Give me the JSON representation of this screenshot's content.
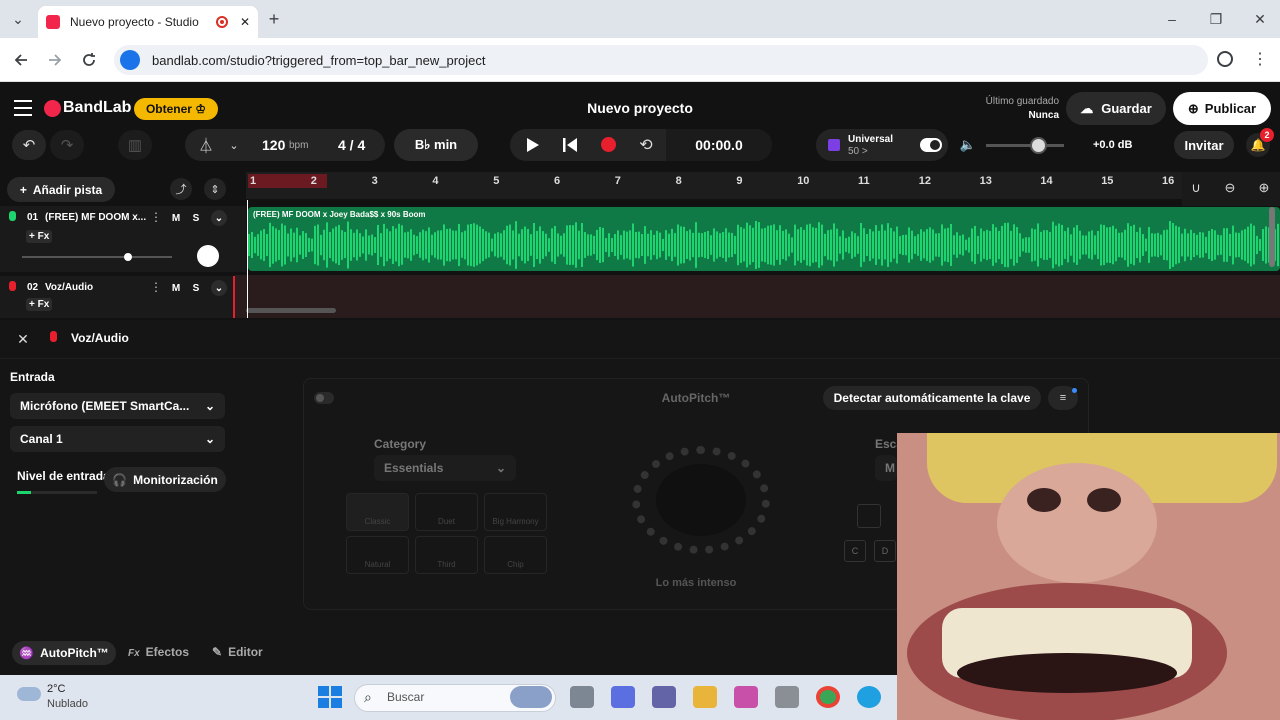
{
  "browser": {
    "tab_title": "Nuevo proyecto - Studio",
    "url": "bandlab.com/studio?triggered_from=top_bar_new_project",
    "new_tab": "+",
    "menu_glyph": "⌄",
    "min": "–",
    "max": "❐",
    "close": "✕"
  },
  "header": {
    "logo": "BandLab",
    "get_label": "Obtener",
    "project_title": "Nuevo proyecto",
    "last_saved_label": "Último guardado",
    "last_saved_value": "Nunca",
    "save_label": "Guardar",
    "publish_label": "Publicar"
  },
  "transport": {
    "tempo": "120",
    "tempo_unit": "bpm",
    "time_sig": "4 / 4",
    "key": "B♭ min",
    "time": "00:00.0",
    "instrument_name": "Universal",
    "instrument_sub": "50 >",
    "volume": "+0.0 dB",
    "invite": "Invitar",
    "notifications": "2"
  },
  "tracks": {
    "add_label": "Añadir pista",
    "items": [
      {
        "num": "01",
        "name": "(FREE) MF DOOM x...",
        "fx": "+ Fx",
        "clip": "(FREE) MF DOOM x Joey Bada$$ x 90s Boom"
      },
      {
        "num": "02",
        "name": "Voz/Audio",
        "fx": "+ Fx"
      }
    ],
    "mute": "M",
    "solo": "S"
  },
  "ruler": {
    "bars": [
      "1",
      "2",
      "3",
      "4",
      "5",
      "6",
      "7",
      "8",
      "9",
      "10",
      "11",
      "12",
      "13",
      "14",
      "15",
      "16"
    ]
  },
  "panel": {
    "title": "Voz/Audio",
    "input_label": "Entrada",
    "mic": "Micrófono (EMEET SmartCa...",
    "channel": "Canal 1",
    "level_label": "Nivel de entrada",
    "monitor": "Monitorización",
    "autopitch_title": "AutoPitch™",
    "detect_key": "Detectar automáticamente la clave",
    "category_label": "Category",
    "category_value": "Essentials",
    "scale_label": "Esca",
    "scale_value": "M",
    "effects": [
      "Classic",
      "Duet",
      "Big Harmony",
      "Natural",
      "Third",
      "Chip"
    ],
    "notes": [
      "C",
      "D"
    ],
    "dial_label": "Lo más intenso",
    "tabs": [
      "AutoPitch™",
      "Efectos",
      "Editor"
    ],
    "tab_fx_glyph": "Fx"
  },
  "taskbar": {
    "temp": "2°C",
    "weather": "Nublado",
    "search": "Buscar"
  },
  "colors": {
    "accent_green": "#1ed46f",
    "brand_red": "#f2264b",
    "gold": "#f5b800"
  }
}
